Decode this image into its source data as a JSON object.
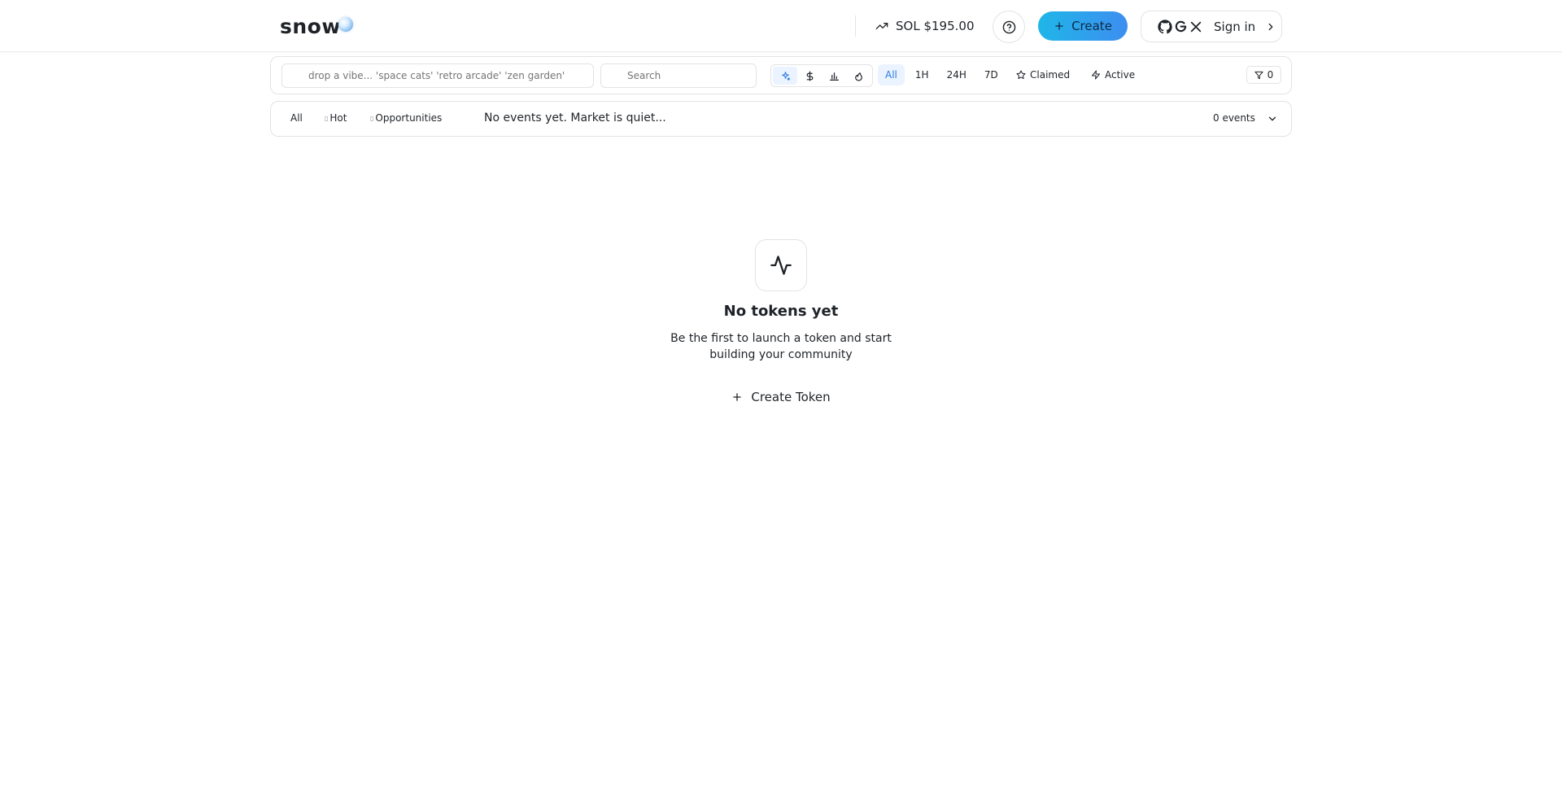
{
  "header": {
    "logo": "snow",
    "sol_price": "SOL $195.00",
    "create_label": "Create",
    "signin_label": "Sign in"
  },
  "filters": {
    "vibe_placeholder": "drop a vibe... 'space cats' 'retro arcade' 'zen garden'",
    "search_placeholder": "Search",
    "sort_icons": [
      "sparkles-icon",
      "dollar-icon",
      "bar-chart-icon",
      "flame-icon"
    ],
    "time_ranges": [
      "All",
      "1H",
      "24H",
      "7D"
    ],
    "active_time_range": "All",
    "claimed_label": "Claimed",
    "active_label": "Active",
    "filter_count": "0"
  },
  "events": {
    "tabs": [
      {
        "label": "All",
        "icon": ""
      },
      {
        "label": "Hot",
        "icon": "placeholder-glyph"
      },
      {
        "label": "Opportunities",
        "icon": "placeholder-glyph"
      }
    ],
    "message": "No events yet. Market is quiet...",
    "count": "0 events"
  },
  "empty_state": {
    "title": "No tokens yet",
    "description": "Be the first to launch a token and start building your community",
    "cta_label": "Create Token"
  },
  "colors": {
    "accent": "#2f7de1",
    "create_gradient_start": "#1fb6e8",
    "create_gradient_end": "#3d8ef0",
    "border": "#e3e3e3",
    "text": "#1f2328"
  }
}
